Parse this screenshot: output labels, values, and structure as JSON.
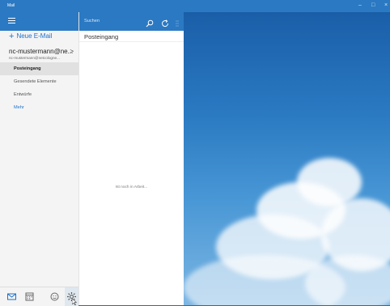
{
  "window": {
    "title": "Mail",
    "minimize_glyph": "–",
    "maximize_glyph": "□",
    "close_glyph": "×"
  },
  "nav": {
    "new_mail_label": "Neue E-Mail",
    "account_name": "nc-mustermann@ne...",
    "account_email": "nc-mustermann@netcologne...",
    "account_chevron": ">",
    "folders": [
      {
        "label": "Posteingang",
        "active": true
      },
      {
        "label": "Gesendete Elemente",
        "active": false
      },
      {
        "label": "Entwürfe",
        "active": false
      }
    ],
    "more_label": "Mehr",
    "bottom_icons": [
      "mail-icon",
      "calendar-icon",
      "feedback-smiley-icon",
      "settings-gear-icon"
    ]
  },
  "list": {
    "search_placeholder": "Suchen",
    "folder_title": "Posteingang",
    "status_text": "Ist noch in Arbeit..."
  },
  "colors": {
    "accent": "#2b79c2",
    "link": "#1e71c9"
  }
}
